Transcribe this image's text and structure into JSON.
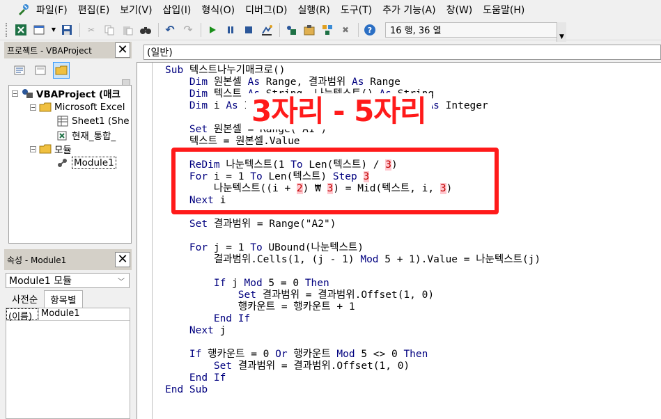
{
  "menu": {
    "items": [
      "파일(F)",
      "편집(E)",
      "보기(V)",
      "삽입(I)",
      "형식(O)",
      "디버그(D)",
      "실행(R)",
      "도구(T)",
      "추가 기능(A)",
      "창(W)",
      "도움말(H)"
    ]
  },
  "toolbar": {
    "status": "16 행, 36 열"
  },
  "project": {
    "title": "프로젝트 - VBAProject",
    "tree": {
      "root": "VBAProject (매크",
      "folder_excel": "Microsoft Excel",
      "sheet1": "Sheet1 (She",
      "workbook": "현재_통합_",
      "folder_modules": "모듈",
      "module1": "Module1"
    }
  },
  "properties": {
    "title": "속성 - Module1",
    "selected": "Module1 모듈",
    "tabs": [
      "사전순",
      "항목별"
    ],
    "rows": [
      {
        "key": "(이름)",
        "value": "Module1"
      }
    ]
  },
  "code": {
    "header": "(일반)",
    "lines": [
      [
        [
          "kw",
          "Sub "
        ],
        [
          "tx",
          "텍스트나누기매크로()"
        ]
      ],
      [
        [
          "kw",
          "    Dim "
        ],
        [
          "tx",
          "원본셀 "
        ],
        [
          "kw",
          "As "
        ],
        [
          "tx",
          "Range, 결과범위 "
        ],
        [
          "kw",
          "As "
        ],
        [
          "tx",
          "Range"
        ]
      ],
      [
        [
          "kw",
          "    Dim "
        ],
        [
          "tx",
          "텍스트 "
        ],
        [
          "kw",
          "As "
        ],
        [
          "tx",
          "String, 나눈텍스트() "
        ],
        [
          "kw",
          "As "
        ],
        [
          "tx",
          "String"
        ]
      ],
      [
        [
          "kw",
          "    Dim "
        ],
        [
          "tx",
          "i "
        ],
        [
          "kw",
          "As "
        ],
        [
          "tx",
          "Integer, j "
        ],
        [
          "kw",
          "As "
        ],
        [
          "tx",
          "Integer, 행카운트 "
        ],
        [
          "kw",
          "As "
        ],
        [
          "tx",
          "Integer"
        ]
      ],
      [],
      [
        [
          "kw",
          "    Set "
        ],
        [
          "tx",
          "원본셀 = Range(\"A1\")"
        ]
      ],
      [
        [
          "tx",
          "    텍스트 = 원본셀.Value"
        ]
      ],
      [],
      [
        [
          "kw",
          "    ReDim "
        ],
        [
          "tx",
          "나눈텍스트(1 "
        ],
        [
          "kw",
          "To "
        ],
        [
          "tx",
          "Len(텍스트) / "
        ],
        [
          "hl",
          "3"
        ],
        [
          "tx",
          ")"
        ]
      ],
      [
        [
          "kw",
          "    For "
        ],
        [
          "tx",
          "i = 1 "
        ],
        [
          "kw",
          "To "
        ],
        [
          "tx",
          "Len(텍스트) "
        ],
        [
          "kw",
          "Step "
        ],
        [
          "hl",
          "3"
        ]
      ],
      [
        [
          "tx",
          "        나눈텍스트((i + "
        ],
        [
          "hl",
          "2"
        ],
        [
          "tx",
          ") ₩ "
        ],
        [
          "hl",
          "3"
        ],
        [
          "tx",
          ") = Mid(텍스트, i, "
        ],
        [
          "hl",
          "3"
        ],
        [
          "tx",
          ")"
        ]
      ],
      [
        [
          "kw",
          "    Next "
        ],
        [
          "tx",
          "i"
        ]
      ],
      [],
      [
        [
          "kw",
          "    Set "
        ],
        [
          "tx",
          "결과범위 = Range(\"A2\")"
        ]
      ],
      [],
      [
        [
          "kw",
          "    For "
        ],
        [
          "tx",
          "j = 1 "
        ],
        [
          "kw",
          "To "
        ],
        [
          "tx",
          "UBound(나눈텍스트)"
        ]
      ],
      [
        [
          "tx",
          "        결과범위.Cells(1, (j - 1) "
        ],
        [
          "kw",
          "Mod "
        ],
        [
          "tx",
          "5 + 1).Value = 나눈텍스트(j)"
        ]
      ],
      [],
      [
        [
          "kw",
          "        If "
        ],
        [
          "tx",
          "j "
        ],
        [
          "kw",
          "Mod "
        ],
        [
          "tx",
          "5 = 0 "
        ],
        [
          "kw",
          "Then"
        ]
      ],
      [
        [
          "kw",
          "            Set "
        ],
        [
          "tx",
          "결과범위 = 결과범위.Offset(1, 0)"
        ]
      ],
      [
        [
          "tx",
          "            행카운트 = 행카운트 + 1"
        ]
      ],
      [
        [
          "kw",
          "        End If"
        ]
      ],
      [
        [
          "kw",
          "    Next "
        ],
        [
          "tx",
          "j"
        ]
      ],
      [],
      [
        [
          "kw",
          "    If "
        ],
        [
          "tx",
          "행카운트 = 0 "
        ],
        [
          "kw",
          "Or "
        ],
        [
          "tx",
          "행카운트 "
        ],
        [
          "kw",
          "Mod "
        ],
        [
          "tx",
          "5 <> 0 "
        ],
        [
          "kw",
          "Then"
        ]
      ],
      [
        [
          "kw",
          "        Set "
        ],
        [
          "tx",
          "결과범위 = 결과범위.Offset(1, 0)"
        ]
      ],
      [
        [
          "kw",
          "    End If"
        ]
      ],
      [
        [
          "kw",
          "End Sub"
        ]
      ]
    ]
  },
  "overlay": {
    "title": "3자리 - 5자리",
    "color": "#ff1a1a"
  }
}
